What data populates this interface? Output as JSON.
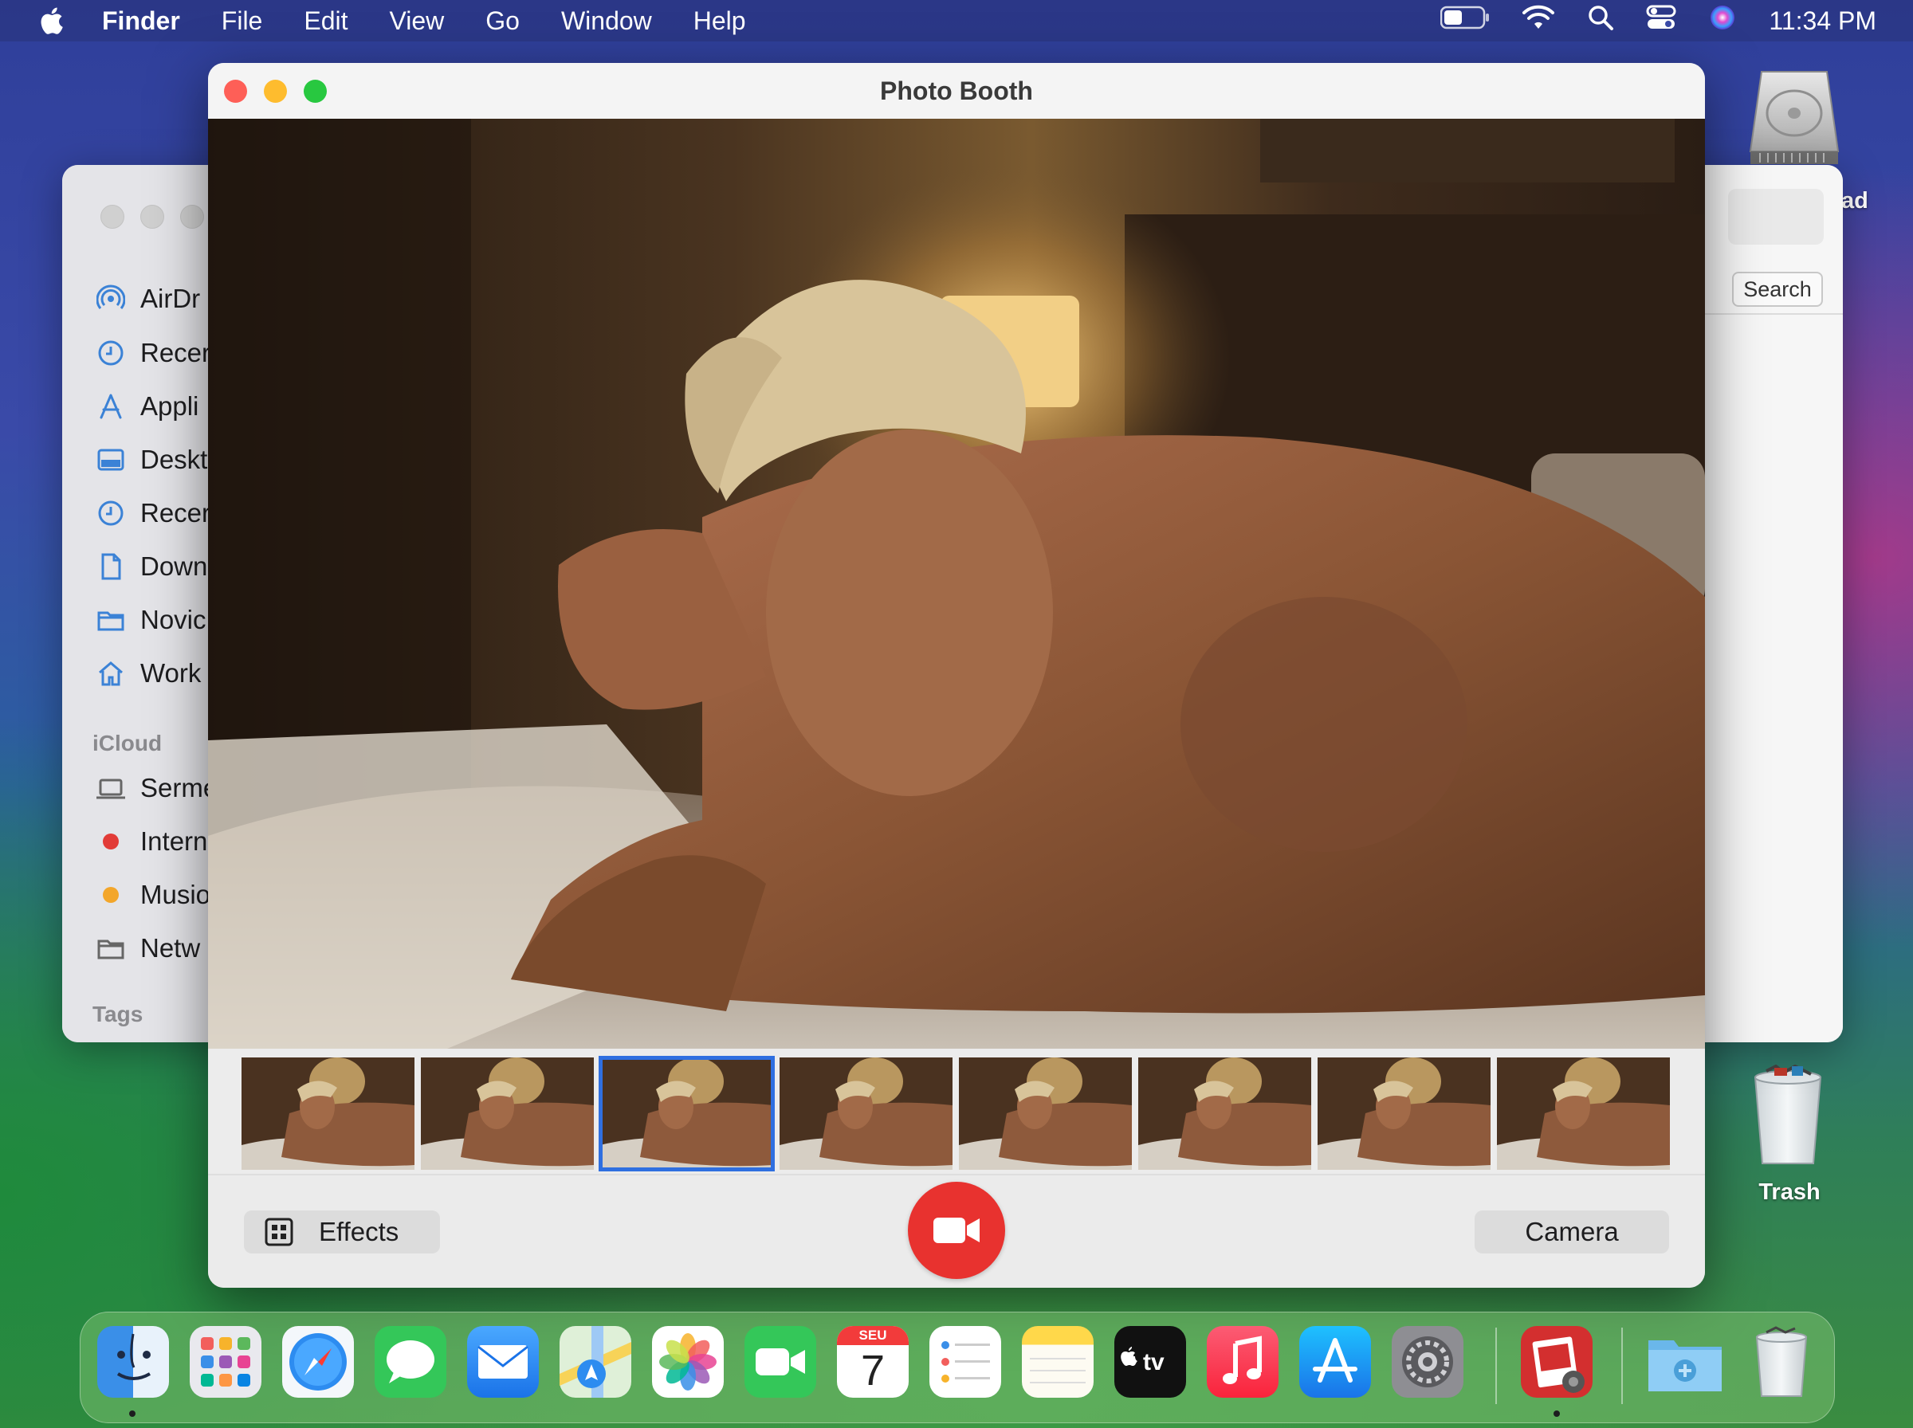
{
  "menubar": {
    "app_name": "Finder",
    "items": [
      "File",
      "Edit",
      "View",
      "Go",
      "Window",
      "Help"
    ],
    "clock": "11:34 PM",
    "status_icons": [
      "battery-icon",
      "wifi-icon",
      "spotlight-search-icon",
      "control-center-icon",
      "siri-icon"
    ]
  },
  "desktop": {
    "drive_label": "ad",
    "trash_label": "Trash"
  },
  "finder": {
    "sidebar_items": [
      "AirDr",
      "Recer",
      "Appli",
      "Deskt",
      "Recer",
      "Down",
      "Novic",
      "Work"
    ],
    "icloud_heading": "iCloud",
    "icloud_items": [
      "Serme",
      "Intern",
      "Musio",
      "Netw"
    ],
    "tags_heading": "Tags",
    "search_label": "Search"
  },
  "photobooth": {
    "title": "Photo Booth",
    "effects_label": "Effects",
    "camera_label": "Camera",
    "thumbnail_count": 8,
    "selected_thumbnail": 3
  },
  "dock": {
    "apps": [
      "Finder",
      "Launchpad",
      "Safari",
      "Messages",
      "Mail",
      "Maps",
      "Photos",
      "FaceTime",
      "Calendar",
      "Reminders",
      "Notes",
      "TV",
      "Music",
      "App Store",
      "System Settings",
      "Photo Booth",
      "Downloads",
      "Trash"
    ],
    "calendar_month": "SEU",
    "calendar_day": "7"
  },
  "colors": {
    "close": "#fe5f57",
    "minimize": "#febc2e",
    "zoom": "#28c840",
    "record": "#e8322f",
    "selection": "#2f6fe0"
  }
}
